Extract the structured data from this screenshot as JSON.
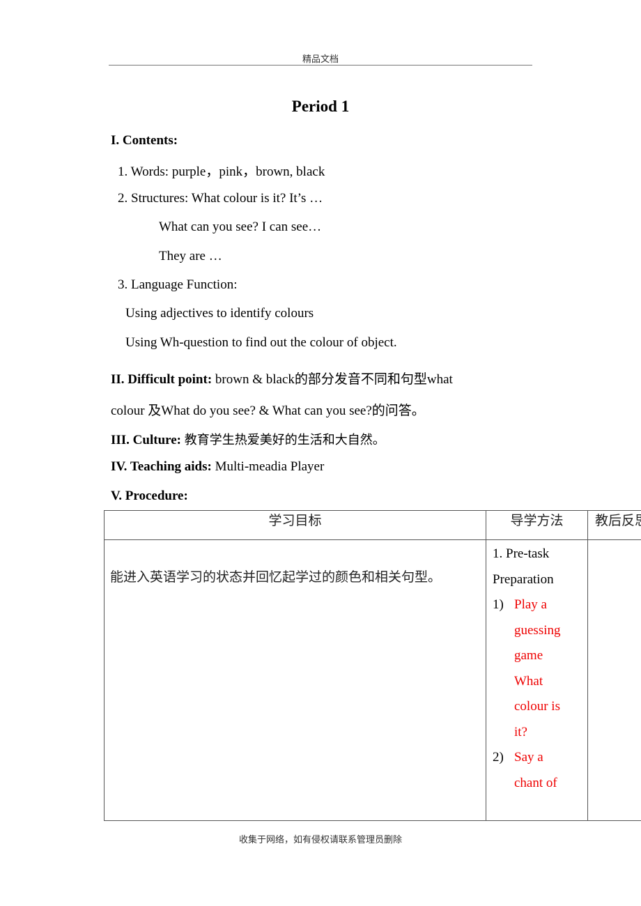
{
  "page_header": "精品文档",
  "title": "Period 1",
  "contents": {
    "heading": "I. Contents:",
    "words": "1. Words: purple，pink，brown, black",
    "structures": "2. Structures: What colour is it? It’s …",
    "structure_line2": "What can you see?  I can see…",
    "structure_line3": "They are …",
    "language_function": "3. Language Function:",
    "function_line1": "Using adjectives to identify colours",
    "function_line2": "Using Wh-question to find out the colour of object."
  },
  "difficult_point": {
    "label": "II. Difficult point:",
    "text_line1": "brown & black的部分发音不同和句型what",
    "text_line2": "colour 及What do you see? & What can you see?的问答。"
  },
  "culture": {
    "label": "III. Culture:",
    "text": "教育学生热爱美好的生活和大自然。"
  },
  "teaching_aids": {
    "label": "IV. Teaching aids:",
    "text": "Multi-meadia Player"
  },
  "procedure": {
    "label": "V. Procedure:",
    "table": {
      "headers": [
        "学习目标",
        "导学方法",
        "教后反思"
      ],
      "rows": [
        {
          "goal": "能进入英语学习的状态并回忆起学过的颜色和相关句型。",
          "method": {
            "stage_line1": "1. Pre-task",
            "stage_line2": "Preparation",
            "items": [
              {
                "num": "1)",
                "lines": [
                  "Play a",
                  "guessing",
                  "game",
                  "What",
                  "colour is",
                  "it?"
                ]
              },
              {
                "num": "2)",
                "lines": [
                  "Say a",
                  "chant of"
                ]
              }
            ]
          },
          "reflection": ""
        }
      ]
    }
  },
  "page_footer": "收集于网络，如有侵权请联系管理员删除",
  "colors": {
    "highlight_red": "#ee0000",
    "text": "#000000"
  }
}
